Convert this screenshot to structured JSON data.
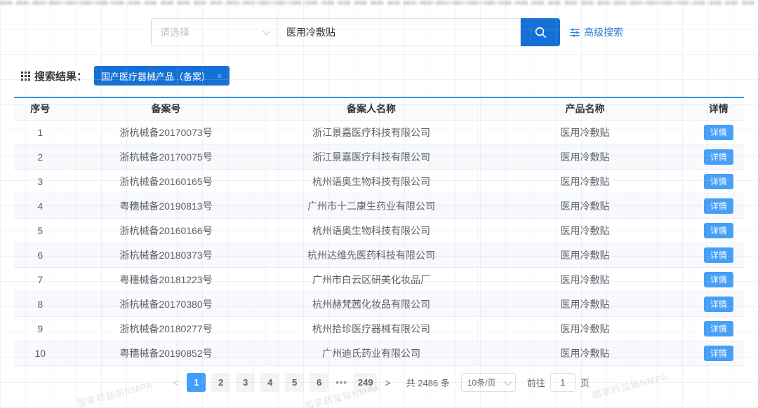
{
  "search": {
    "category_placeholder": "请选择",
    "query_value": "医用冷敷贴",
    "advanced_label": "高级搜索"
  },
  "results": {
    "label": "搜索结果：",
    "tag": "国产医疗器械产品（备案）",
    "tag_close": "×"
  },
  "table": {
    "columns": [
      "序号",
      "备案号",
      "备案人名称",
      "产品名称",
      "详情"
    ],
    "detail_label": "详情",
    "rows": [
      {
        "no": "1",
        "record_no": "浙杭械备20170073号",
        "registrant": "浙江景嘉医疗科技有限公司",
        "product": "医用冷敷贴"
      },
      {
        "no": "2",
        "record_no": "浙杭械备20170075号",
        "registrant": "浙江景嘉医疗科技有限公司",
        "product": "医用冷敷贴"
      },
      {
        "no": "3",
        "record_no": "浙杭械备20160165号",
        "registrant": "杭州语奥生物科技有限公司",
        "product": "医用冷敷贴"
      },
      {
        "no": "4",
        "record_no": "粤穗械备20190813号",
        "registrant": "广州市十二康生药业有限公司",
        "product": "医用冷敷贴"
      },
      {
        "no": "5",
        "record_no": "浙杭械备20160166号",
        "registrant": "杭州语奥生物科技有限公司",
        "product": "医用冷敷贴"
      },
      {
        "no": "6",
        "record_no": "浙杭械备20180373号",
        "registrant": "杭州达维先医药科技有限公司",
        "product": "医用冷敷贴"
      },
      {
        "no": "7",
        "record_no": "粤穗械备20181223号",
        "registrant": "广州市白云区研美化妆品厂",
        "product": "医用冷敷贴"
      },
      {
        "no": "8",
        "record_no": "浙杭械备20170380号",
        "registrant": "杭州赫梵茜化妆品有限公司",
        "product": "医用冷敷贴"
      },
      {
        "no": "9",
        "record_no": "浙杭械备20180277号",
        "registrant": "杭州拾珍医疗器械有限公司",
        "product": "医用冷敷贴"
      },
      {
        "no": "10",
        "record_no": "粤穗械备20190852号",
        "registrant": "广州迪氏药业有限公司",
        "product": "医用冷敷贴"
      }
    ]
  },
  "pagination": {
    "prev_icon": "<",
    "next_icon": ">",
    "pages": [
      "1",
      "2",
      "3",
      "4",
      "5",
      "6"
    ],
    "ellipsis": "•••",
    "last_page": "249",
    "active_page": "1",
    "total_text": "共 2486 条",
    "page_size": "10条/页",
    "goto_label": "前往",
    "goto_value": "1",
    "goto_suffix": "页"
  },
  "watermark": {
    "text": "国家药监局NMPA"
  },
  "colors": {
    "primary_blue": "#1470d4",
    "light_blue": "#409eff",
    "detail_button_blue": "#459ff6",
    "link_blue": "#2c7cd5",
    "table_top_border": "#3e8de8",
    "stripe_row": "#f7f9fc"
  }
}
